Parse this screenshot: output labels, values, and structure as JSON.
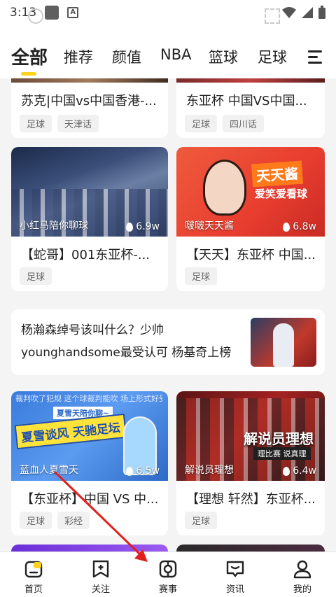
{
  "status_bar": {
    "time": "3:13"
  },
  "tabs": [
    {
      "label": "全部",
      "active": true
    },
    {
      "label": "推荐"
    },
    {
      "label": "颜值"
    },
    {
      "label": "NBA"
    },
    {
      "label": "篮球"
    },
    {
      "label": "足球"
    }
  ],
  "feed": {
    "top_cards": [
      {
        "title": "苏克|中国vs中国香港-...",
        "tags": [
          "足球",
          "天津话"
        ]
      },
      {
        "title": "东亚杯 中国VS中国...",
        "tags": [
          "足球",
          "四川话"
        ]
      }
    ],
    "video_cards_row1": [
      {
        "anchor": "小红马陪你聊球",
        "views": "6.9w",
        "title": "【蛇哥】001东亚杯-...",
        "tags": [
          "足球"
        ]
      },
      {
        "anchor": "啵啵天天酱",
        "views": "6.8w",
        "title": "【天天】东亚杯 中国...",
        "tags": [
          "足球"
        ],
        "overlay": {
          "banner": "天天酱",
          "sub": "爱笑爱看球"
        }
      }
    ],
    "news": {
      "text": "杨瀚森绰号该叫什么？少帅younghandsome最受认可 杨基奇上榜"
    },
    "video_cards_row2": [
      {
        "anchor": "蓝血人夏雪天",
        "views": "6.5w",
        "title": "【东亚杯】中国 VS 中...",
        "tags": [
          "足球",
          "彩经"
        ],
        "overlay": {
          "banner": "夏雪谈风 天驰足坛",
          "sub": "夏雪天陪你聊~",
          "top": "裁判吹了犯规   这个球裁判能吹   场上形式好受到"
        }
      },
      {
        "anchor": "解说员理想",
        "views": "6.4w",
        "title": "【理想 轩然】东亚杯...",
        "tags": [
          "足球"
        ],
        "overlay": {
          "banner": "解说员理想",
          "sub": "理比赛 说真理"
        }
      }
    ]
  },
  "bottom_nav": [
    {
      "label": "首页",
      "icon": "home-icon"
    },
    {
      "label": "关注",
      "icon": "follow-icon"
    },
    {
      "label": "赛事",
      "icon": "match-icon"
    },
    {
      "label": "资讯",
      "icon": "news-icon"
    },
    {
      "label": "我的",
      "icon": "profile-icon"
    }
  ],
  "colors": {
    "accent": "#ffd21e",
    "annotation": "#e0201c"
  }
}
